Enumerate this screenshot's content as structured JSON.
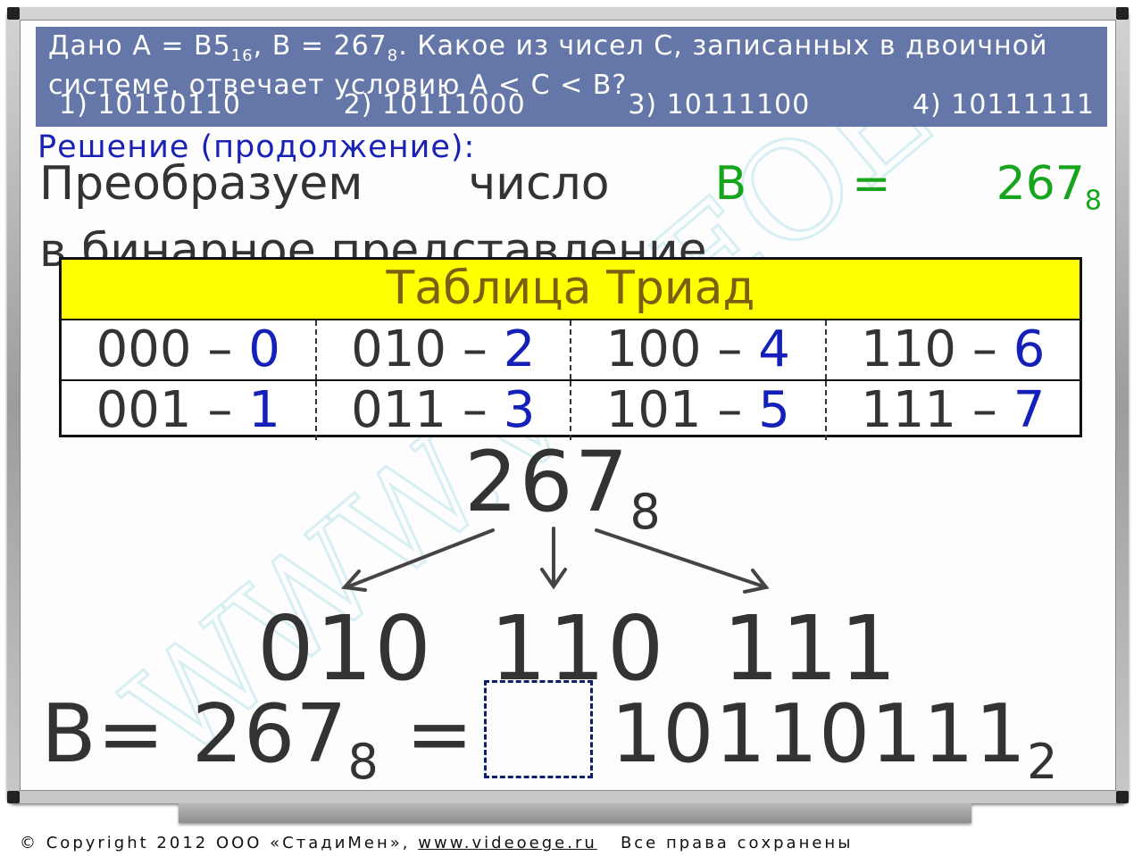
{
  "problem": {
    "statement_prefix": "Дано А = B5",
    "a_base": "16",
    "statement_mid": ", В = 267",
    "b_base": "8",
    "statement_suffix": ". Какое из чисел С, записанных в двоичной системе, отвечает условию A < C < B?",
    "answers": [
      "1) 10110110",
      "2) 10111000",
      "3) 10111100",
      "4) 10111111"
    ]
  },
  "solution_label": "Решение (продолжение):",
  "instruction": {
    "word1": "Преобразуем",
    "word2": "число",
    "b_var": "B",
    "eq_sign": "=",
    "b_value": "267",
    "b_base": "8",
    "line2": "в бинарное представление."
  },
  "triad_table": {
    "title": "Таблица Триад",
    "rows": [
      [
        {
          "bits": "000",
          "dash": "–",
          "digit": "0"
        },
        {
          "bits": "010",
          "dash": "–",
          "digit": "2"
        },
        {
          "bits": "100",
          "dash": "–",
          "digit": "4"
        },
        {
          "bits": "110",
          "dash": "–",
          "digit": "6"
        }
      ],
      [
        {
          "bits": "001",
          "dash": "–",
          "digit": "1"
        },
        {
          "bits": "011",
          "dash": "–",
          "digit": "3"
        },
        {
          "bits": "101",
          "dash": "–",
          "digit": "5"
        },
        {
          "bits": "111",
          "dash": "–",
          "digit": "7"
        }
      ]
    ]
  },
  "conversion": {
    "octal": "267",
    "octal_base": "8",
    "triads": [
      "010",
      "110",
      "111"
    ],
    "lhs": "B= 267",
    "lhs_base": "8",
    "eq": "=",
    "result": "10110111",
    "result_base": "2"
  },
  "footer": {
    "copyright_symbol": "©",
    "copyright_text": "Copyright 2012 ООО «СтадиМен»,",
    "link": "www.videoege.ru",
    "rights": "Все права сохранены"
  },
  "colors": {
    "panel": "#6477a8",
    "heading_blue": "#1a22b5",
    "green": "#17a51e",
    "triad_header": "#ffff00",
    "digit_blue": "#1520b8"
  },
  "icons": [
    "arrow-left-down-icon",
    "arrow-down-icon",
    "arrow-right-down-icon"
  ]
}
